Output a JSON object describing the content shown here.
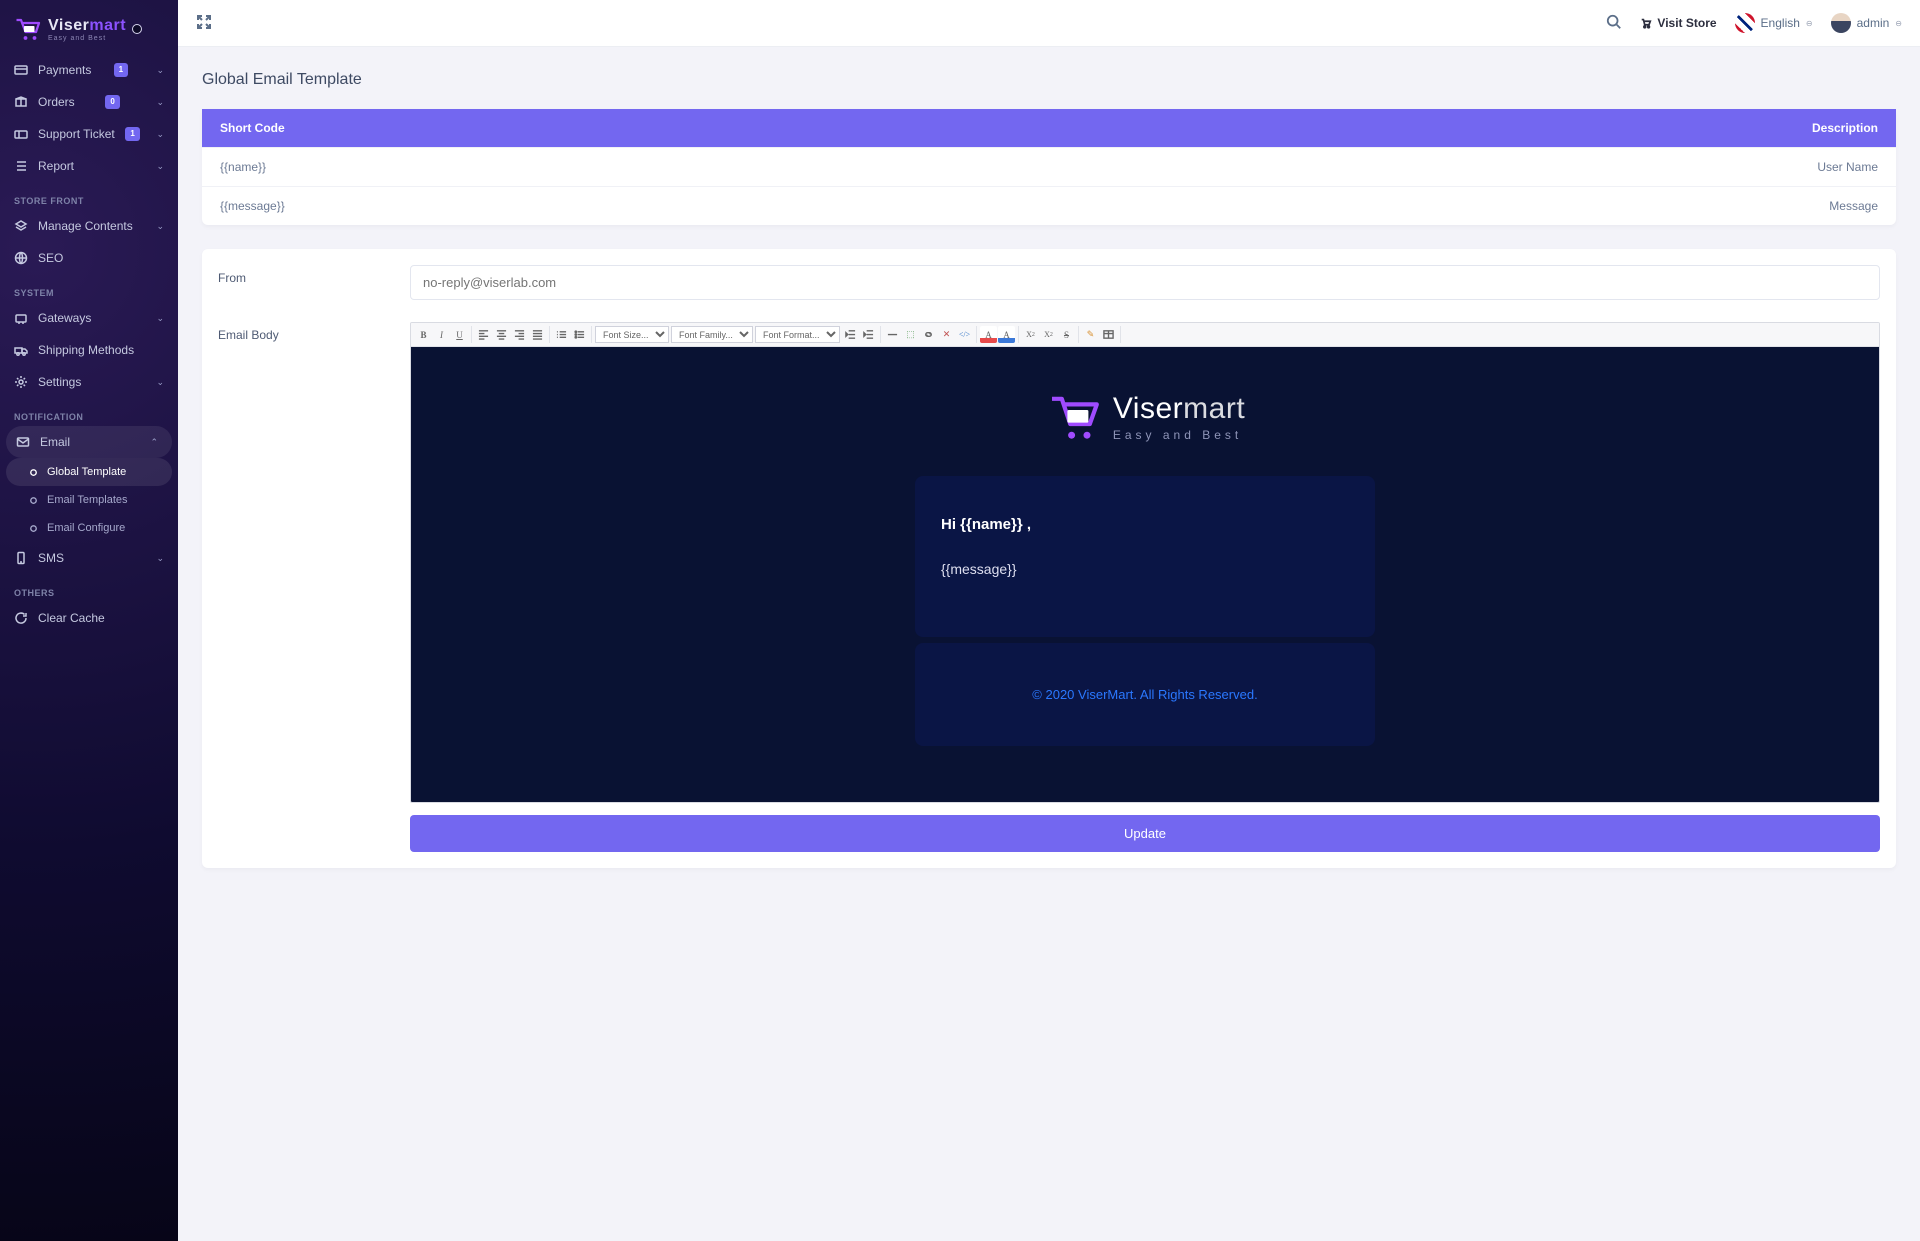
{
  "brand": {
    "name": "Visermart",
    "suffix": "mart",
    "tagline": "Easy and Best"
  },
  "topbar": {
    "visit": "Visit Store",
    "lang": "English",
    "user": "admin"
  },
  "page": {
    "title": "Global Email Template"
  },
  "sidebar": {
    "items": [
      {
        "label": "Payments",
        "badge": "1",
        "icon": "card",
        "chev": true
      },
      {
        "label": "Orders",
        "badge": "0",
        "icon": "box",
        "chev": true
      },
      {
        "label": "Support Ticket",
        "badge": "1",
        "icon": "ticket",
        "chev": true
      },
      {
        "label": "Report",
        "icon": "list",
        "chev": true
      }
    ],
    "sections": [
      {
        "heading": "STORE FRONT",
        "items": [
          {
            "label": "Manage Contents",
            "icon": "layers",
            "chev": true
          },
          {
            "label": "SEO",
            "icon": "globe"
          }
        ]
      },
      {
        "heading": "SYSTEM",
        "items": [
          {
            "label": "Gateways",
            "icon": "gateway",
            "chev": true
          },
          {
            "label": "Shipping Methods",
            "icon": "truck"
          },
          {
            "label": "Settings",
            "icon": "settings",
            "chev": true
          }
        ]
      },
      {
        "heading": "NOTIFICATION",
        "items": [
          {
            "label": "Email",
            "icon": "mail",
            "chev": true,
            "open": true,
            "sub": [
              {
                "label": "Global Template",
                "active": true
              },
              {
                "label": "Email Templates"
              },
              {
                "label": "Email Configure"
              }
            ]
          },
          {
            "label": "SMS",
            "icon": "sms",
            "chev": true
          }
        ]
      },
      {
        "heading": "OTHERS",
        "items": [
          {
            "label": "Clear Cache",
            "icon": "refresh"
          }
        ]
      }
    ]
  },
  "table": {
    "headers": {
      "col1": "Short Code",
      "col2": "Description"
    },
    "rows": [
      {
        "code": "{{name}}",
        "desc": "User Name"
      },
      {
        "code": "{{message}}",
        "desc": "Message"
      }
    ]
  },
  "form": {
    "from_label": "From",
    "from_placeholder": "no-reply@viserlab.com",
    "body_label": "Email Body",
    "update": "Update"
  },
  "editor_tools": {
    "size": "Font Size...",
    "family": "Font Family...",
    "format": "Font Format..."
  },
  "preview": {
    "greeting": "Hi {{name}} ,",
    "message": "{{message}}",
    "footer": "© 2020 ViserMart. All Rights Reserved."
  }
}
